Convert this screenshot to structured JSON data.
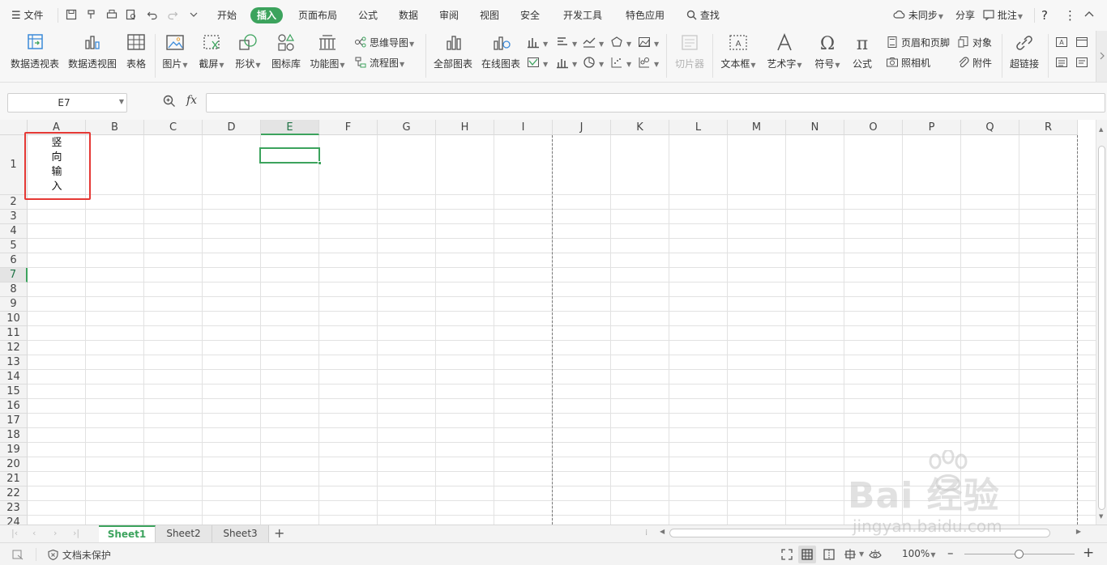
{
  "menubar": {
    "file_label": "文件",
    "tabs": [
      {
        "label": "开始"
      },
      {
        "label": "插入"
      },
      {
        "label": "页面布局"
      },
      {
        "label": "公式"
      },
      {
        "label": "数据"
      },
      {
        "label": "审阅"
      },
      {
        "label": "视图"
      },
      {
        "label": "安全"
      },
      {
        "label": "开发工具"
      },
      {
        "label": "特色应用"
      }
    ],
    "active_tab": "插入",
    "search_label": "查找",
    "sync_label": "未同步",
    "share_label": "分享",
    "comment_label": "批注",
    "help_label": "?"
  },
  "ribbon": {
    "pivot_table": "数据透视表",
    "pivot_chart": "数据透视图",
    "table": "表格",
    "picture": "图片",
    "screenshot": "截屏",
    "shape": "形状",
    "icon_lib": "图标库",
    "func_chart": "功能图",
    "mind_map": "思维导图",
    "flowchart": "流程图",
    "all_charts": "全部图表",
    "online_charts": "在线图表",
    "slicer": "切片器",
    "textbox": "文本框",
    "wordart": "艺术字",
    "symbol": "符号",
    "formula": "公式",
    "header_footer": "页眉和页脚",
    "object": "对象",
    "camera": "照相机",
    "attachment": "附件",
    "hyperlink": "超链接"
  },
  "formula_bar": {
    "name_box": "E7",
    "fx_label": "fx",
    "formula_value": ""
  },
  "grid": {
    "columns": [
      "A",
      "B",
      "C",
      "D",
      "E",
      "F",
      "G",
      "H",
      "I",
      "J",
      "K",
      "L",
      "M",
      "N",
      "O",
      "P",
      "Q",
      "R"
    ],
    "rows": [
      "1",
      "2",
      "3",
      "4",
      "5",
      "6",
      "7",
      "8",
      "9",
      "10",
      "11",
      "12",
      "13",
      "14",
      "15",
      "16",
      "17",
      "18",
      "19",
      "20",
      "21",
      "22",
      "23",
      "24"
    ],
    "selected_column": "E",
    "selected_row": "7",
    "cell_a1_chars": [
      "竖",
      "向",
      "输",
      "入"
    ]
  },
  "sheets": {
    "tabs": [
      {
        "label": "Sheet1"
      },
      {
        "label": "Sheet2"
      },
      {
        "label": "Sheet3"
      }
    ],
    "active": "Sheet1",
    "add_label": "+"
  },
  "statusbar": {
    "protect_label": "文档未保护",
    "zoom_label": "100%",
    "minus_label": "–",
    "plus_label": "+",
    "zoom_level_percent": 100
  },
  "watermark": {
    "main": "Bai 经验",
    "sub": "jingyan.baidu.com"
  },
  "colors": {
    "accent": "#3ca35d",
    "highlight_red": "#e53935"
  }
}
